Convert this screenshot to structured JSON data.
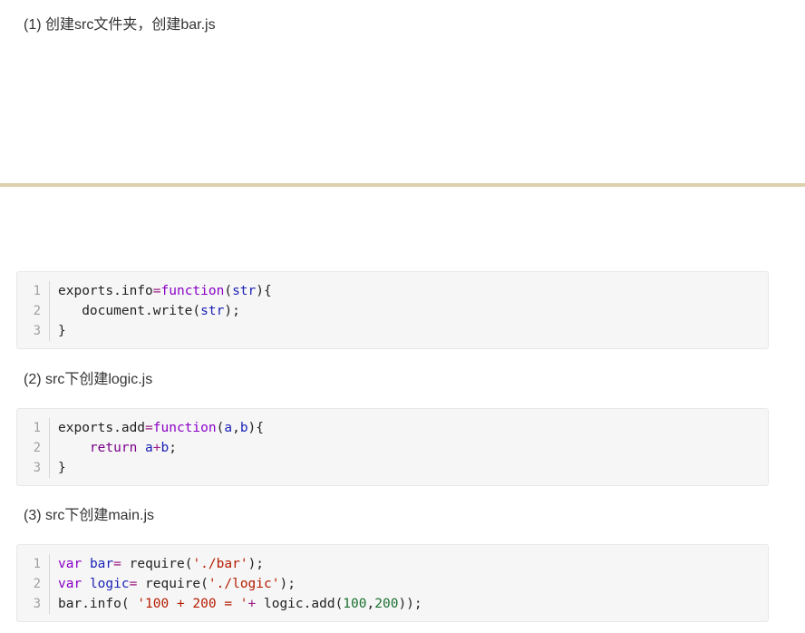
{
  "steps": [
    "(1) 创建src文件夹，创建bar.js",
    "(2) src下创建logic.js",
    "(3) src下创建main.js"
  ],
  "line_numbers": [
    "1",
    "2",
    "3"
  ],
  "code_blocks": [
    {
      "lines": [
        [
          {
            "t": "exports.info",
            "c": "pl"
          },
          {
            "t": "=",
            "c": "op"
          },
          {
            "t": "function",
            "c": "kw"
          },
          {
            "t": "(",
            "c": "pl"
          },
          {
            "t": "str",
            "c": "id"
          },
          {
            "t": "){",
            "c": "pl"
          }
        ],
        [
          {
            "t": "   document.write(",
            "c": "pl"
          },
          {
            "t": "str",
            "c": "id"
          },
          {
            "t": ");",
            "c": "pl"
          }
        ],
        [
          {
            "t": "}",
            "c": "pl"
          }
        ]
      ]
    },
    {
      "lines": [
        [
          {
            "t": "exports.add",
            "c": "pl"
          },
          {
            "t": "=",
            "c": "op"
          },
          {
            "t": "function",
            "c": "kw"
          },
          {
            "t": "(",
            "c": "pl"
          },
          {
            "t": "a",
            "c": "id"
          },
          {
            "t": ",",
            "c": "pl"
          },
          {
            "t": "b",
            "c": "id"
          },
          {
            "t": "){",
            "c": "pl"
          }
        ],
        [
          {
            "t": "    ",
            "c": "pl"
          },
          {
            "t": "return",
            "c": "kw2"
          },
          {
            "t": " ",
            "c": "pl"
          },
          {
            "t": "a",
            "c": "id"
          },
          {
            "t": "+",
            "c": "op"
          },
          {
            "t": "b",
            "c": "id"
          },
          {
            "t": ";",
            "c": "pl"
          }
        ],
        [
          {
            "t": "}",
            "c": "pl"
          }
        ]
      ]
    },
    {
      "lines": [
        [
          {
            "t": "var",
            "c": "kw"
          },
          {
            "t": " ",
            "c": "pl"
          },
          {
            "t": "bar",
            "c": "id"
          },
          {
            "t": "=",
            "c": "op"
          },
          {
            "t": " require(",
            "c": "pl"
          },
          {
            "t": "'./bar'",
            "c": "str"
          },
          {
            "t": ");",
            "c": "pl"
          }
        ],
        [
          {
            "t": "var",
            "c": "kw"
          },
          {
            "t": " ",
            "c": "pl"
          },
          {
            "t": "logic",
            "c": "id"
          },
          {
            "t": "=",
            "c": "op"
          },
          {
            "t": " require(",
            "c": "pl"
          },
          {
            "t": "'./logic'",
            "c": "str"
          },
          {
            "t": ");",
            "c": "pl"
          }
        ],
        [
          {
            "t": "bar.info( ",
            "c": "pl"
          },
          {
            "t": "'100 + 200 = '",
            "c": "str"
          },
          {
            "t": "+",
            "c": "op"
          },
          {
            "t": " logic.add(",
            "c": "pl"
          },
          {
            "t": "100",
            "c": "num"
          },
          {
            "t": ",",
            "c": "pl"
          },
          {
            "t": "200",
            "c": "num"
          },
          {
            "t": "));",
            "c": "pl"
          }
        ]
      ]
    }
  ]
}
